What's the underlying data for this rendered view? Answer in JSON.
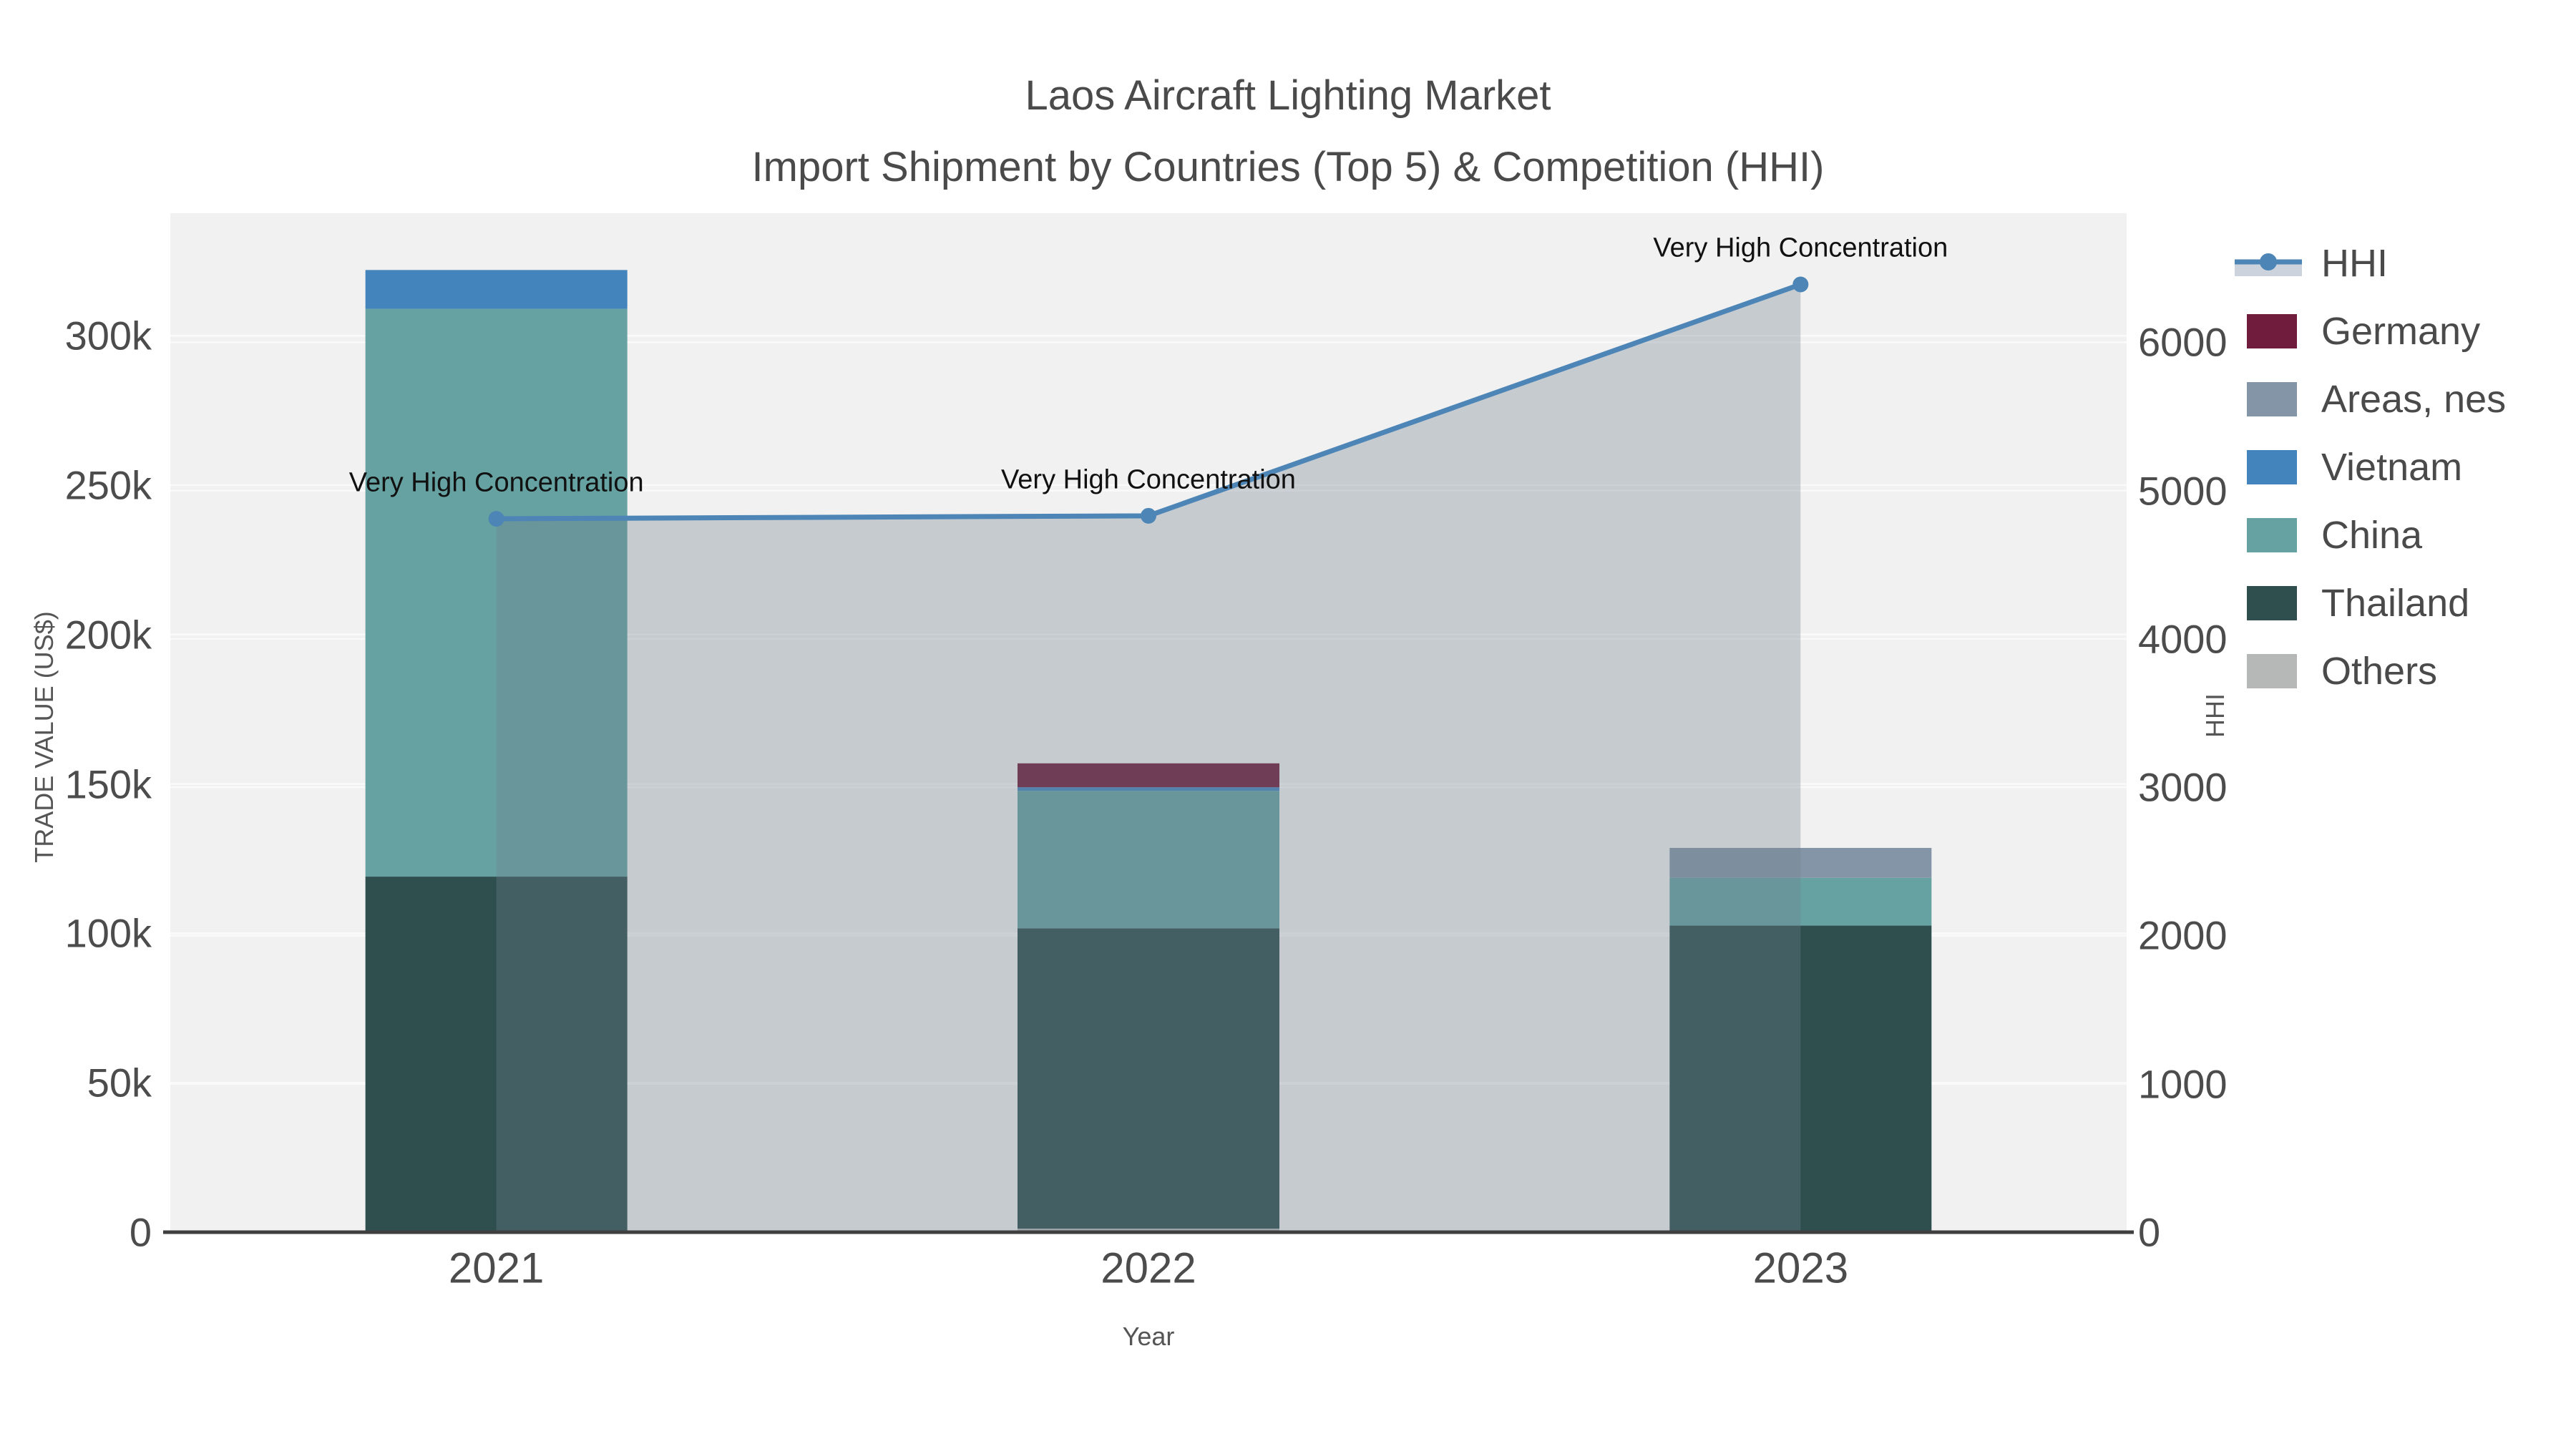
{
  "title": {
    "line1": "Laos Aircraft Lighting Market",
    "line2": "Import Shipment by Countries (Top 5) & Competition (HHI)"
  },
  "legend": {
    "items": [
      {
        "label": "HHI",
        "type": "line",
        "color": "#4c85b6",
        "band": "#ccd3dc"
      },
      {
        "label": "Germany",
        "type": "swatch",
        "color": "#701d3d"
      },
      {
        "label": "Areas, nes",
        "type": "swatch",
        "color": "#8495a7"
      },
      {
        "label": "Vietnam",
        "type": "swatch",
        "color": "#4384bc"
      },
      {
        "label": "China",
        "type": "swatch",
        "color": "#66a2a2"
      },
      {
        "label": "Thailand",
        "type": "swatch",
        "color": "#2f4f4f"
      },
      {
        "label": "Others",
        "type": "swatch",
        "color": "#b5b8b7"
      }
    ]
  },
  "chart_data": {
    "type": "combo: stacked bar (trade value) + line with area fill (HHI)",
    "title": "Laos Aircraft Lighting Market — Import Shipment by Countries (Top 5) & Competition (HHI)",
    "categories": [
      "2021",
      "2022",
      "2023"
    ],
    "x": {
      "label": "Year"
    },
    "y_left": {
      "label": "TRADE VALUE (US$)",
      "ticks": [
        "0",
        "50k",
        "100k",
        "150k",
        "200k",
        "250k",
        "300k"
      ],
      "tick_values": [
        0,
        50000,
        100000,
        150000,
        200000,
        250000,
        300000
      ],
      "max": 341000
    },
    "y_right": {
      "label": "HHI",
      "ticks": [
        "0",
        "1000",
        "2000",
        "3000",
        "4000",
        "5000",
        "6000"
      ],
      "tick_values": [
        0,
        1000,
        2000,
        3000,
        4000,
        5000,
        6000
      ],
      "max": 6870
    },
    "series": [
      {
        "name": "Others",
        "color": "#b5b8b7",
        "values": [
          0,
          1200,
          600
        ]
      },
      {
        "name": "Thailand",
        "color": "#2f4f4f",
        "values": [
          119000,
          100500,
          102000
        ]
      },
      {
        "name": "China",
        "color": "#66a2a2",
        "values": [
          190000,
          46000,
          16000
        ]
      },
      {
        "name": "Vietnam",
        "color": "#4384bc",
        "values": [
          13000,
          1200,
          0
        ]
      },
      {
        "name": "Areas, nes",
        "color": "#8495a7",
        "values": [
          0,
          0,
          10000
        ]
      },
      {
        "name": "Germany",
        "color": "#701d3d",
        "values": [
          0,
          8000,
          0
        ]
      }
    ],
    "line": {
      "name": "HHI",
      "color": "#4c85b6",
      "area_fill": "rgba(113,128,144,0.33)",
      "values": [
        4810,
        4830,
        6390
      ]
    },
    "annotations": [
      {
        "text": "Very High Concentration",
        "category": "2021"
      },
      {
        "text": "Very High Concentration",
        "category": "2022"
      },
      {
        "text": "Very High Concentration",
        "category": "2023"
      }
    ],
    "grid": true,
    "legend_position": "right",
    "panel_bg": "#f1f1f1",
    "grid_color": "#fafafa",
    "axis_line_color": "#3f3f3f"
  }
}
